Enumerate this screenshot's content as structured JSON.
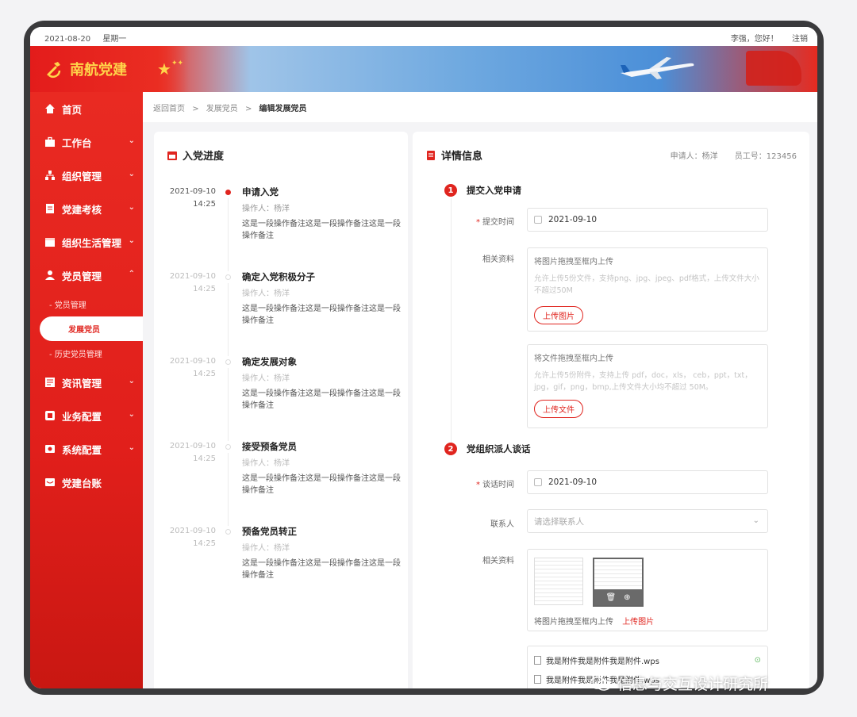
{
  "topbar": {
    "date": "2021-08-20",
    "weekday": "星期一",
    "greeting": "李强，您好！",
    "logout": "注销"
  },
  "brand": {
    "name": "南航党建"
  },
  "sidebar": {
    "items": [
      {
        "label": "首页",
        "icon": "home-icon"
      },
      {
        "label": "工作台",
        "icon": "briefcase-icon"
      },
      {
        "label": "组织管理",
        "icon": "org-icon"
      },
      {
        "label": "党建考核",
        "icon": "assessment-icon"
      },
      {
        "label": "组织生活管理",
        "icon": "calendar-icon"
      },
      {
        "label": "党员管理",
        "icon": "member-icon"
      },
      {
        "label": "资讯管理",
        "icon": "news-icon"
      },
      {
        "label": "业务配置",
        "icon": "business-icon"
      },
      {
        "label": "系统配置",
        "icon": "system-icon"
      },
      {
        "label": "党建台账",
        "icon": "ledger-icon"
      }
    ],
    "subitems": [
      "- 党员管理",
      "发展党员",
      "- 历史党员管理"
    ]
  },
  "breadcrumb": {
    "home": "返回首页",
    "sep": ">",
    "parent": "发展党员",
    "current": "编辑发展党员"
  },
  "progress": {
    "title": "入党进度",
    "steps": [
      {
        "date": "2021-09-10",
        "time": "14:25",
        "title": "申请入党",
        "operator": "操作人：杨洋",
        "note": "这是一段操作备注这是一段操作备注这是一段操作备注"
      },
      {
        "date": "2021-09-10",
        "time": "14:25",
        "title": "确定入党积极分子",
        "operator": "操作人：杨洋",
        "note": "这是一段操作备注这是一段操作备注这是一段操作备注"
      },
      {
        "date": "2021-09-10",
        "time": "14:25",
        "title": "确定发展对象",
        "operator": "操作人：杨洋",
        "note": "这是一段操作备注这是一段操作备注这是一段操作备注"
      },
      {
        "date": "2021-09-10",
        "time": "14:25",
        "title": "接受预备党员",
        "operator": "操作人：杨洋",
        "note": "这是一段操作备注这是一段操作备注这是一段操作备注"
      },
      {
        "date": "2021-09-10",
        "time": "14:25",
        "title": "预备党员转正",
        "operator": "操作人：杨洋",
        "note": "这是一段操作备注这是一段操作备注这是一段操作备注"
      }
    ]
  },
  "detail": {
    "title": "详情信息",
    "applicant": "申请人：杨洋",
    "employee_no": "员工号：123456",
    "step1": {
      "num": "1",
      "title": "提交入党申请",
      "submit_label": "提交时间",
      "submit_value": "2021-09-10",
      "material_label": "相关资料",
      "image_upload": {
        "hint": "将图片拖拽至框内上传",
        "desc": "允许上传5份文件，支持png、jpg、jpeg、pdf格式，上传文件大小不超过50M",
        "button": "上传图片"
      },
      "file_upload": {
        "hint": "将文件拖拽至框内上传",
        "desc": "允许上传5份附件，支持上传 pdf，doc，xls， ceb，ppt，txt，jpg，gif，png，bmp,上传文件大小均不超过 50M。",
        "button": "上传文件"
      }
    },
    "step2": {
      "num": "2",
      "title": "党组织派人谈话",
      "talk_label": "谈话时间",
      "talk_value": "2021-09-10",
      "contact_label": "联系人",
      "contact_placeholder": "请选择联系人",
      "material_label": "相关资料",
      "upload_hint": "将图片拖拽至框内上传",
      "upload_link": "上传图片",
      "files": [
        "我是附件我是附件我是附件.wps",
        "我是附件我是附件我是附件.wps"
      ]
    }
  },
  "watermark": "信息与交互设计研究所",
  "colors": {
    "brand_red": "#e0251f",
    "gold": "#ffd54a"
  }
}
